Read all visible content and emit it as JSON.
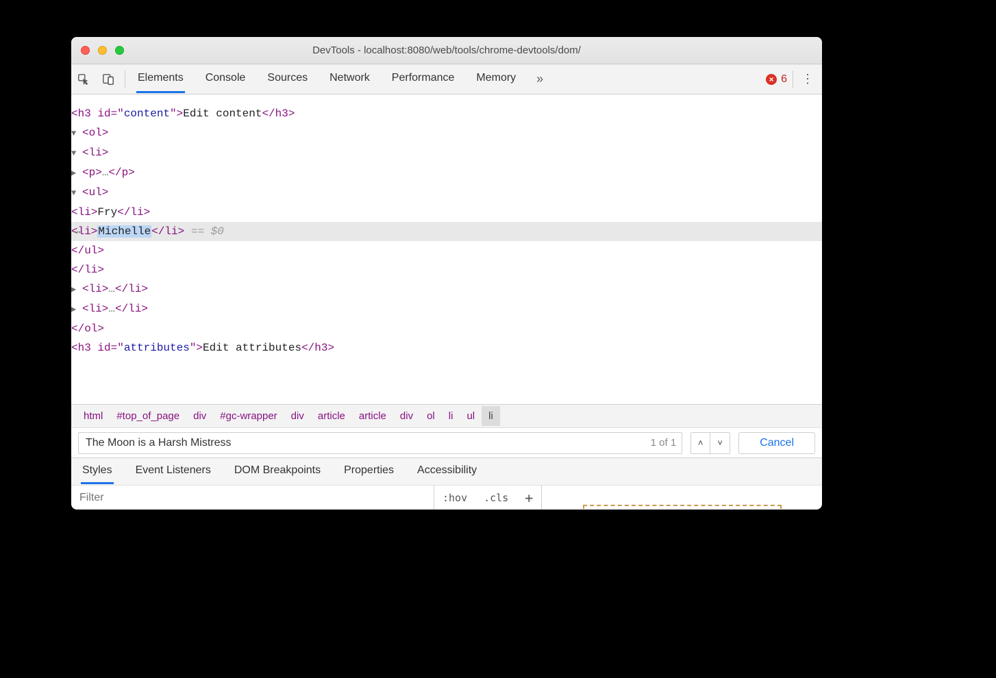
{
  "titlebar": {
    "title": "DevTools - localhost:8080/web/tools/chrome-devtools/dom/"
  },
  "toolbar": {
    "tabs": [
      "Elements",
      "Console",
      "Sources",
      "Network",
      "Performance",
      "Memory"
    ],
    "active_tab_index": 0,
    "overflow_glyph": "»",
    "error_count": "6",
    "error_x": "×"
  },
  "dom": {
    "h3_content_open": "<h3 id=\"",
    "h3_content_attr": "content",
    "h3_content_mid": "\">",
    "h3_content_text": "Edit content",
    "h3_content_close": "</h3>",
    "ol_open": "<ol>",
    "li_open": "<li>",
    "p_collapsed": "<p>",
    "p_ell": "…",
    "p_close": "</p>",
    "ul_open": "<ul>",
    "li_fry_open": "<li>",
    "li_fry_text": "Fry",
    "li_fry_close": "</li>",
    "li_edit_open": "<li>",
    "li_edit_text": "Michelle",
    "li_edit_close": "</li>",
    "equals_dollar": " == $0",
    "ul_close": "</ul>",
    "li_close": "</li>",
    "li_collapsed_open": "<li>",
    "li_collapsed_ell": "…",
    "li_collapsed_close": "</li>",
    "ol_close": "</ol>",
    "h3_attr_open": "<h3 id=\"",
    "h3_attr_attr": "attributes",
    "h3_attr_mid": "\">",
    "h3_attr_text": "Edit attributes",
    "h3_attr_close": "</h3>"
  },
  "breadcrumb": {
    "items": [
      "html",
      "#top_of_page",
      "div",
      "#gc-wrapper",
      "div",
      "article",
      "article",
      "div",
      "ol",
      "li",
      "ul",
      "li"
    ]
  },
  "search": {
    "value": "The Moon is a Harsh Mistress",
    "count": "1 of 1",
    "cancel_label": "Cancel"
  },
  "subtabs": {
    "items": [
      "Styles",
      "Event Listeners",
      "DOM Breakpoints",
      "Properties",
      "Accessibility"
    ],
    "active_index": 0
  },
  "styles_row": {
    "filter_placeholder": "Filter",
    "hov_label": ":hov",
    "cls_label": ".cls",
    "plus_label": "+"
  }
}
